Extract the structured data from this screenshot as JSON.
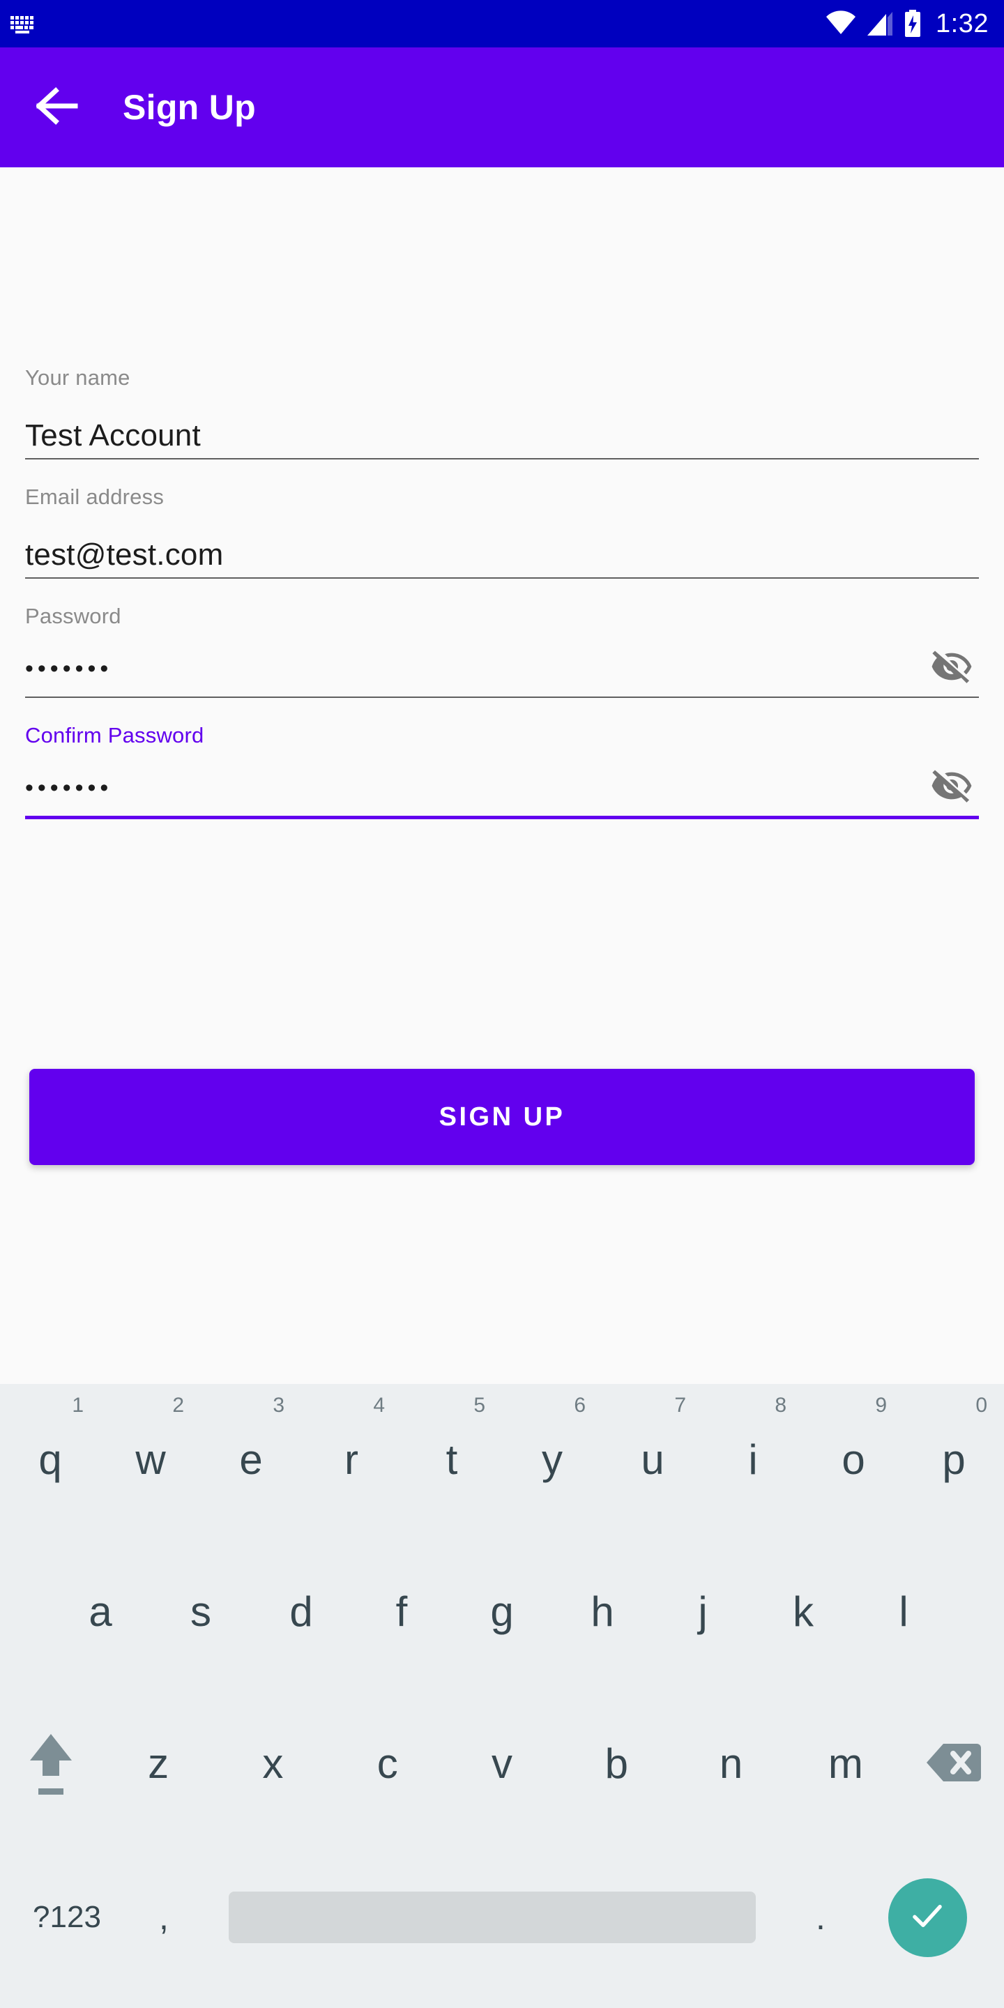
{
  "status_bar": {
    "time": "1:32",
    "icons": [
      "keyboard-ime-icon",
      "wifi-icon",
      "cell-signal-icon",
      "battery-charging-icon"
    ],
    "background_color": "#0000bf"
  },
  "app_bar": {
    "title": "Sign Up",
    "back_icon": "arrow-back-icon",
    "background_color": "#6200ee"
  },
  "form": {
    "fields": [
      {
        "label": "Your name",
        "value": "Test Account",
        "masked": false,
        "focused": false,
        "has_toggle": false
      },
      {
        "label": "Email address",
        "value": "test@test.com",
        "masked": false,
        "focused": false,
        "has_toggle": false
      },
      {
        "label": "Password",
        "value": "•••••••",
        "masked": true,
        "focused": false,
        "has_toggle": true,
        "toggle_icon": "visibility-off-icon"
      },
      {
        "label": "Confirm Password",
        "value": "•••••••",
        "masked": true,
        "focused": true,
        "has_toggle": true,
        "toggle_icon": "visibility-off-icon"
      }
    ]
  },
  "primary_action": {
    "label": "SIGN UP",
    "color": "#6200ee"
  },
  "keyboard": {
    "background_color": "#eceff1",
    "row1": [
      {
        "char": "q",
        "hint": "1"
      },
      {
        "char": "w",
        "hint": "2"
      },
      {
        "char": "e",
        "hint": "3"
      },
      {
        "char": "r",
        "hint": "4"
      },
      {
        "char": "t",
        "hint": "5"
      },
      {
        "char": "y",
        "hint": "6"
      },
      {
        "char": "u",
        "hint": "7"
      },
      {
        "char": "i",
        "hint": "8"
      },
      {
        "char": "o",
        "hint": "9"
      },
      {
        "char": "p",
        "hint": "0"
      }
    ],
    "row2": [
      {
        "char": "a"
      },
      {
        "char": "s"
      },
      {
        "char": "d"
      },
      {
        "char": "f"
      },
      {
        "char": "g"
      },
      {
        "char": "h"
      },
      {
        "char": "j"
      },
      {
        "char": "k"
      },
      {
        "char": "l"
      }
    ],
    "row3": [
      {
        "char": "z"
      },
      {
        "char": "x"
      },
      {
        "char": "c"
      },
      {
        "char": "v"
      },
      {
        "char": "b"
      },
      {
        "char": "n"
      },
      {
        "char": "m"
      }
    ],
    "shift_icon": "shift-icon",
    "backspace_icon": "backspace-icon",
    "symbols_label": "?123",
    "comma_label": ",",
    "period_label": ".",
    "space_label": "",
    "enter_icon": "check-icon",
    "enter_color": "#3eafa4"
  }
}
